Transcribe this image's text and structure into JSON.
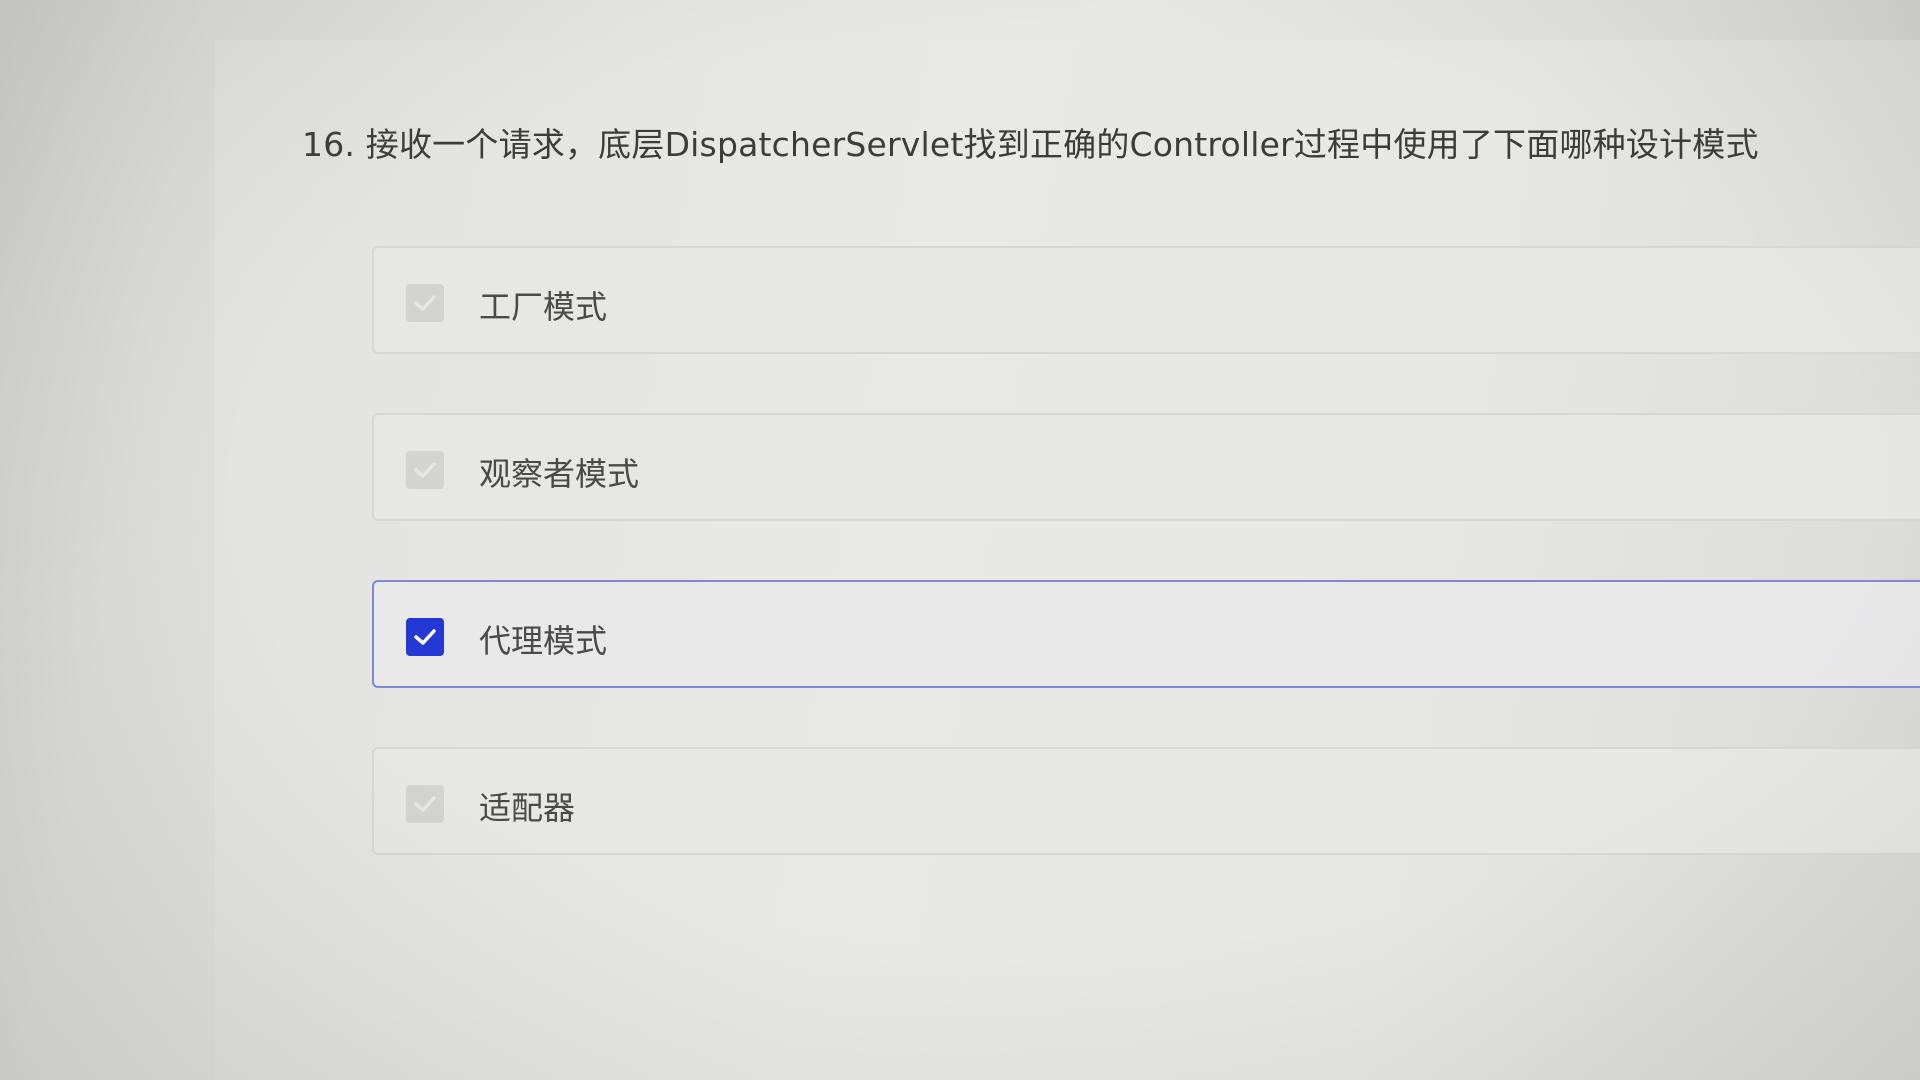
{
  "question": {
    "title": "16. 接收一个请求，底层DispatcherServlet找到正确的Controller过程中使用了下面哪种设计模式"
  },
  "options": [
    {
      "label": "工厂模式",
      "checked": false
    },
    {
      "label": "观察者模式",
      "checked": false
    },
    {
      "label": "代理模式",
      "checked": true
    },
    {
      "label": "适配器",
      "checked": false
    }
  ],
  "colors": {
    "accent": "#2438d6",
    "selected_border": "#7f88d8",
    "unchecked_box": "#d3d3d1"
  }
}
